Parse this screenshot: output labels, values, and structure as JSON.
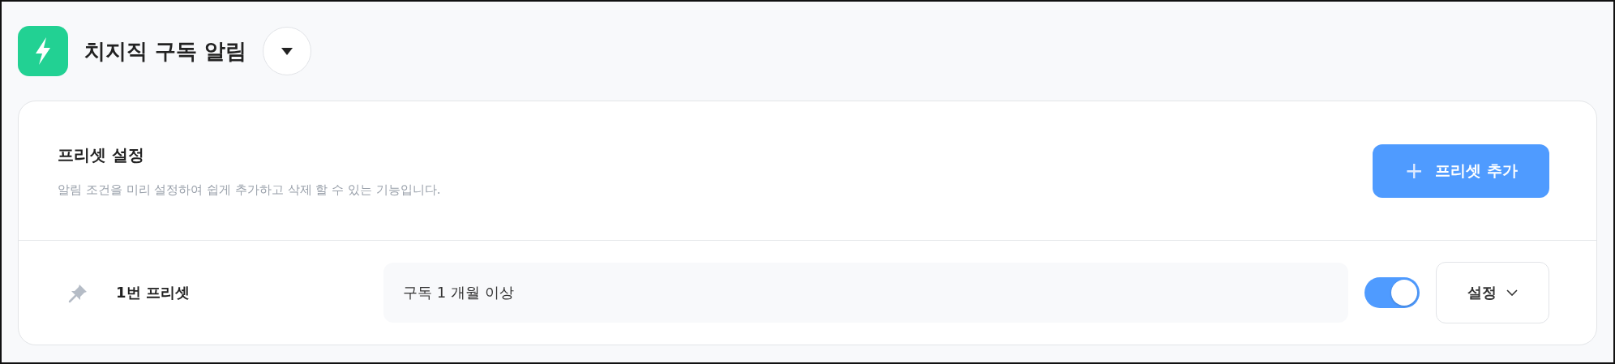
{
  "header": {
    "title": "치지직 구독 알림"
  },
  "card": {
    "title": "프리셋 설정",
    "description": "알림 조건을 미리 설정하여 쉽게 추가하고 삭제 할 수 있는 기능입니다.",
    "add_button": {
      "icon": "+",
      "label": "프리셋 추가"
    }
  },
  "presets": [
    {
      "name": "1번 프리셋",
      "condition": "구독 1 개월 이상",
      "on": true,
      "settings_button": "설정"
    }
  ]
}
